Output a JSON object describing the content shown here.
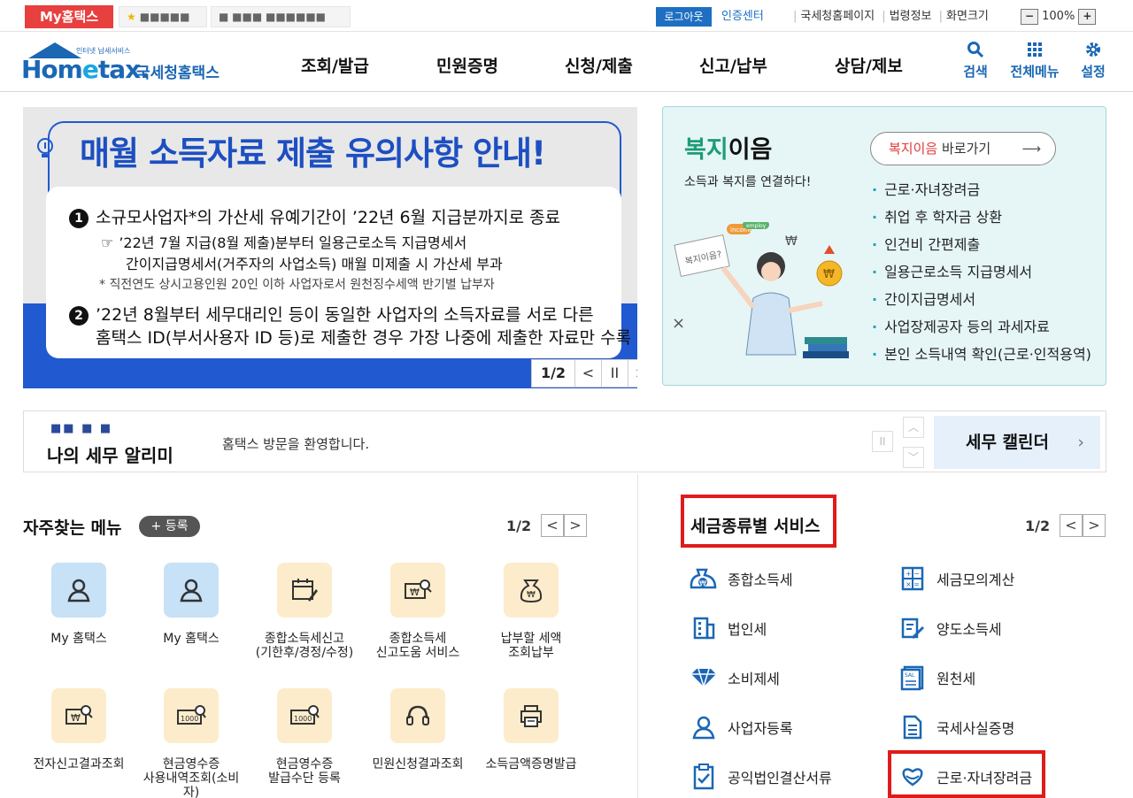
{
  "topbar": {
    "my_hometax": "My홈택스",
    "blurred_1": "■■■■■",
    "blurred_2": "■ ■■■ ■■■■■■",
    "logout": "로그아웃",
    "cert_center": "인증센터",
    "links": [
      "국세청홈페이지",
      "법령정보",
      "화면크기"
    ],
    "zoom_minus": "−",
    "zoom_level": "100%",
    "zoom_plus": "+"
  },
  "header": {
    "logo_en_pre": "Hom",
    "logo_en_e": "e",
    "logo_en_post": "tax.",
    "logo_kr": "국세청홈택스",
    "logo_tagline": "인터넷 납세서비스",
    "nav": [
      "조회/발급",
      "민원증명",
      "신청/제출",
      "신고/납부",
      "상담/제보"
    ],
    "icons": [
      {
        "label": "검색",
        "icon": "search-icon"
      },
      {
        "label": "전체메뉴",
        "icon": "grid-menu-icon"
      },
      {
        "label": "설정",
        "icon": "gear-icon"
      }
    ]
  },
  "banner": {
    "title": "매월 소득자료 제출 유의사항 안내!",
    "item1": "소규모사업자*의 가산세 유예기간이 ’22년 6월 지급분까지로 종료",
    "item1_sub1": "’22년 7월 지급(8월 제출)분부터 일용근로소득 지급명세서",
    "item1_sub2": "간이지급명세서(거주자의 사업소득) 매월 미제출 시 가산세 부과",
    "item1_note": "* 직전연도 상시고용인원 20인 이하 사업자로서 원천징수세액 반기별 납부자",
    "item2_line1": "’22년 8월부터 세무대리인 등이 동일한 사업자의 소득자료를 서로 다른",
    "item2_line2": "홈택스 ID(부서사용자 ID 등)로 제출한 경우 가장 나중에 제출한 자료만 수록",
    "num1": "1",
    "num2": "2",
    "page": "1/2",
    "prev": "<",
    "pause": "II",
    "next": ">"
  },
  "welfare": {
    "title_green": "복지",
    "title_rest": "이음",
    "subtitle": "소득과 복지를 연결하다!",
    "btn_red": "복지이음",
    "btn_rest": " 바로가기",
    "btn_arrow": "⟶",
    "items": [
      "근로·자녀장려금",
      "취업 후 학자금 상환",
      "인건비 간편제출",
      "일용근로소득 지급명세서",
      "간이지급명세서",
      "사업장제공자 등의 과세자료",
      "본인 소득내역 확인(근로·인적용역)"
    ],
    "illus_sign": "복지이음?",
    "illus_tag1": "employ",
    "illus_tag2": "income"
  },
  "notice": {
    "user_blur": "■■ ■ ■",
    "title": "나의 세무 알리미",
    "message": "홈택스 방문을 환영합니다.",
    "pause": "II",
    "up": "︿",
    "down": "﹀",
    "calendar": "세무 캘린더",
    "calendar_arrow": "›"
  },
  "frequent": {
    "title": "자주찾는 메뉴",
    "register": "+ 등록",
    "page": "1/2",
    "prev": "<",
    "next": ">",
    "items": [
      {
        "label": "My 홈택스",
        "icon": "person-icon"
      },
      {
        "label": "My 홈택스",
        "icon": "person-icon"
      },
      {
        "label": "종합소득세신고\n(기한후/경정/수정)",
        "icon": "calendar-edit-icon"
      },
      {
        "label": "종합소득세\n신고도움 서비스",
        "icon": "won-search-icon"
      },
      {
        "label": "납부할 세액\n조회납부",
        "icon": "money-bag-icon"
      },
      {
        "label": "전자신고결과조회",
        "icon": "won-search-icon"
      },
      {
        "label": "현금영수증\n사용내역조회(소비\n자)",
        "icon": "receipt-search-icon"
      },
      {
        "label": "현금영수증\n발급수단 등록",
        "icon": "receipt-card-icon"
      },
      {
        "label": "민원신청결과조회",
        "icon": "headset-icon"
      },
      {
        "label": "소득금액증명발급",
        "icon": "printer-icon"
      }
    ]
  },
  "taxservice": {
    "title": "세금종류별 서비스",
    "page": "1/2",
    "prev": "<",
    "next": ">",
    "items": [
      {
        "label": "종합소득세",
        "icon": "money-bag-won-icon"
      },
      {
        "label": "세금모의계산",
        "icon": "calculator-icon"
      },
      {
        "label": "법인세",
        "icon": "building-icon"
      },
      {
        "label": "양도소득세",
        "icon": "document-sign-icon"
      },
      {
        "label": "소비제세",
        "icon": "diamond-icon"
      },
      {
        "label": "원천세",
        "icon": "receipt-icon"
      },
      {
        "label": "사업자등록",
        "icon": "person-icon"
      },
      {
        "label": "국세사실증명",
        "icon": "document-icon"
      },
      {
        "label": "공익법인결산서류",
        "icon": "clipboard-check-icon"
      },
      {
        "label": "근로·자녀장려금",
        "icon": "heart-hands-icon"
      }
    ]
  },
  "colors": {
    "brand_blue": "#1b67b4",
    "banner_blue": "#2159d0",
    "highlight_red": "#e01b1b",
    "my_hometax_red": "#e83f3f"
  }
}
